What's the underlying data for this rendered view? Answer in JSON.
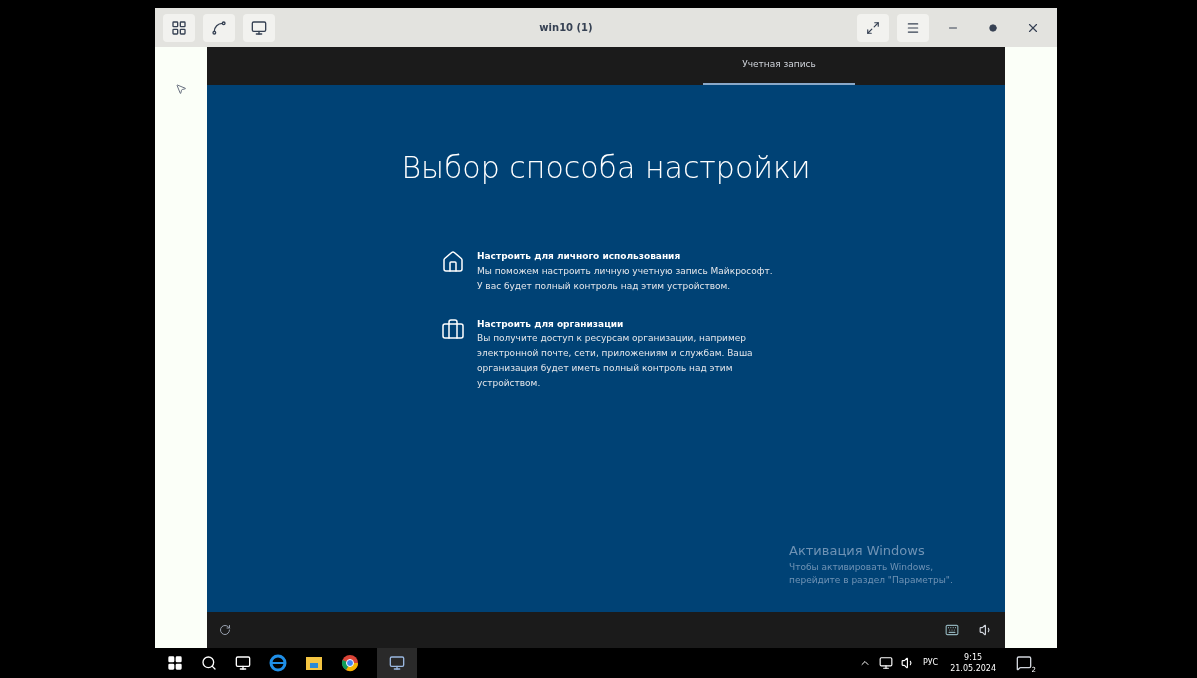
{
  "window": {
    "title": "win10 (1)"
  },
  "vm": {
    "header_tab": {
      "label": "Учетная запись",
      "selected": true
    },
    "heading": "Выбор способа настройки",
    "options": [
      {
        "kind": "personal",
        "title": "Настроить для личного использования",
        "description": "Мы поможем настроить личную учетную запись Майкрософт. У вас будет полный контроль над этим устройством."
      },
      {
        "kind": "organization",
        "title": "Настроить для организации",
        "description": "Вы получите доступ к ресурсам организации, например электронной почте, сети, приложениям и службам. Ваша организация будет иметь полный контроль над этим устройством."
      }
    ],
    "activation": {
      "title": "Активация Windows",
      "text_line_1": "Чтобы активировать Windows,",
      "text_line_2": "перейдите в раздел \"Параметры\"."
    }
  },
  "taskbar": {
    "language": "РУС",
    "time": "9:15",
    "date": "21.05.2024",
    "notification_count": "2"
  }
}
